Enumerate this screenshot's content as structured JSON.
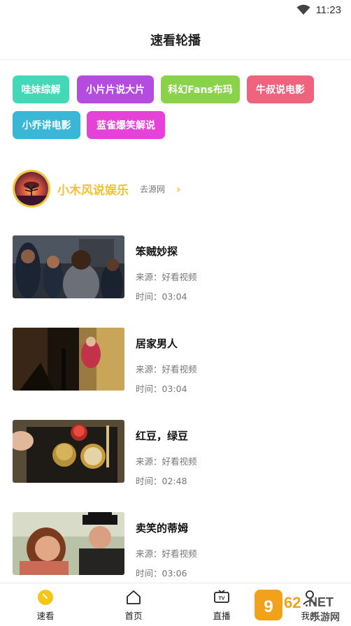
{
  "status_bar": {
    "time": "11:23",
    "icons": [
      "wifi-icon",
      "signal-icon"
    ]
  },
  "header": {
    "title": "速看轮播"
  },
  "tags": [
    {
      "label": "哇妹综解",
      "color": "#43d9b8"
    },
    {
      "label": "小片片说大片",
      "color": "#b44ce0"
    },
    {
      "label": "科幻Fans布玛",
      "color": "#8ad24a"
    },
    {
      "label": "牛叔说电影",
      "color": "#f0637f"
    },
    {
      "label": "小乔讲电影",
      "color": "#3ab7d6"
    },
    {
      "label": "蓝雀爆笑解说",
      "color": "#e542d8"
    }
  ],
  "channel": {
    "name": "小木风说娱乐",
    "source_link": "去源网",
    "chevron": "›",
    "accent": "#f2c230"
  },
  "videos": [
    {
      "title": "笨贼妙探",
      "source": "来源：好看视频",
      "time": "时间：03:04"
    },
    {
      "title": "居家男人",
      "source": "来源：好看视频",
      "time": "时间：03:04"
    },
    {
      "title": "红豆，绿豆",
      "source": "来源：好看视频",
      "time": "时间：02:48"
    },
    {
      "title": "卖笑的蒂姆",
      "source": "来源：好看视频",
      "time": "时间：03:06"
    }
  ],
  "tabbar": {
    "items": [
      {
        "label": "速看",
        "icon": "speed-icon",
        "active": true
      },
      {
        "label": "首页",
        "icon": "home-icon",
        "active": false
      },
      {
        "label": "直播",
        "icon": "tv-icon",
        "active": false
      },
      {
        "label": "我的",
        "icon": "user-icon",
        "active": false
      }
    ]
  },
  "watermark": {
    "text": "962.NET",
    "sub": "乐游网"
  }
}
